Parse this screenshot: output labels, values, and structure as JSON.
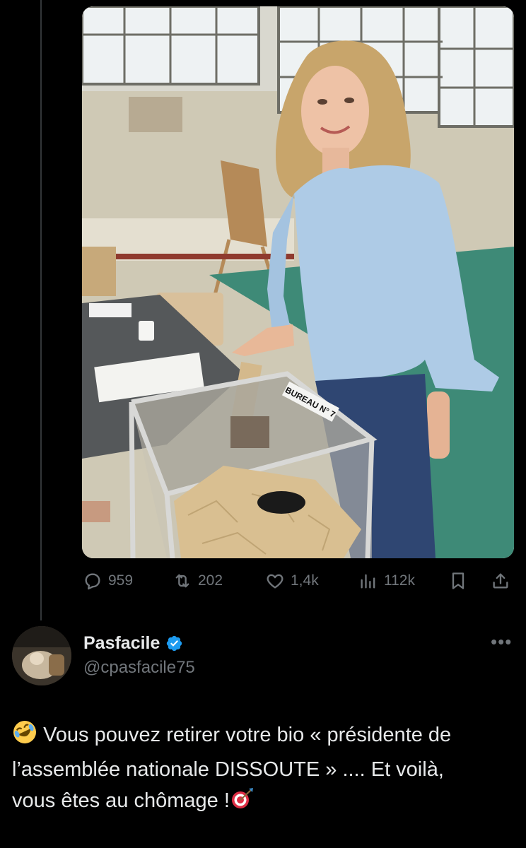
{
  "post": {
    "stats": {
      "replies": "959",
      "reposts": "202",
      "likes": "1,4k",
      "views": "112k"
    },
    "ballot_box_label": "BUREAU N° 7"
  },
  "reply": {
    "display_name": "Pasfacile",
    "verified": true,
    "handle": "@cpasfacile75",
    "text_line1": "Vous pouvez retirer votre bio « présidente de",
    "text_line2": "l’assemblée nationale DISSOUTE » .... Et voilà,",
    "text_line3": "vous êtes au chômage !",
    "leading_emoji": "rolling-on-floor-laughing-emoji",
    "trailing_emoji": "direct-hit-target-emoji"
  },
  "icons": {
    "reply": "reply-icon",
    "repost": "repost-icon",
    "like": "heart-icon",
    "views": "views-chart-icon",
    "bookmark": "bookmark-icon",
    "share": "share-icon",
    "verified": "verified-badge-icon",
    "more": "more-options-icon"
  },
  "colors": {
    "background": "#000000",
    "text": "#e7e9ea",
    "muted": "#71767b",
    "verified": "#1d9bf0"
  }
}
